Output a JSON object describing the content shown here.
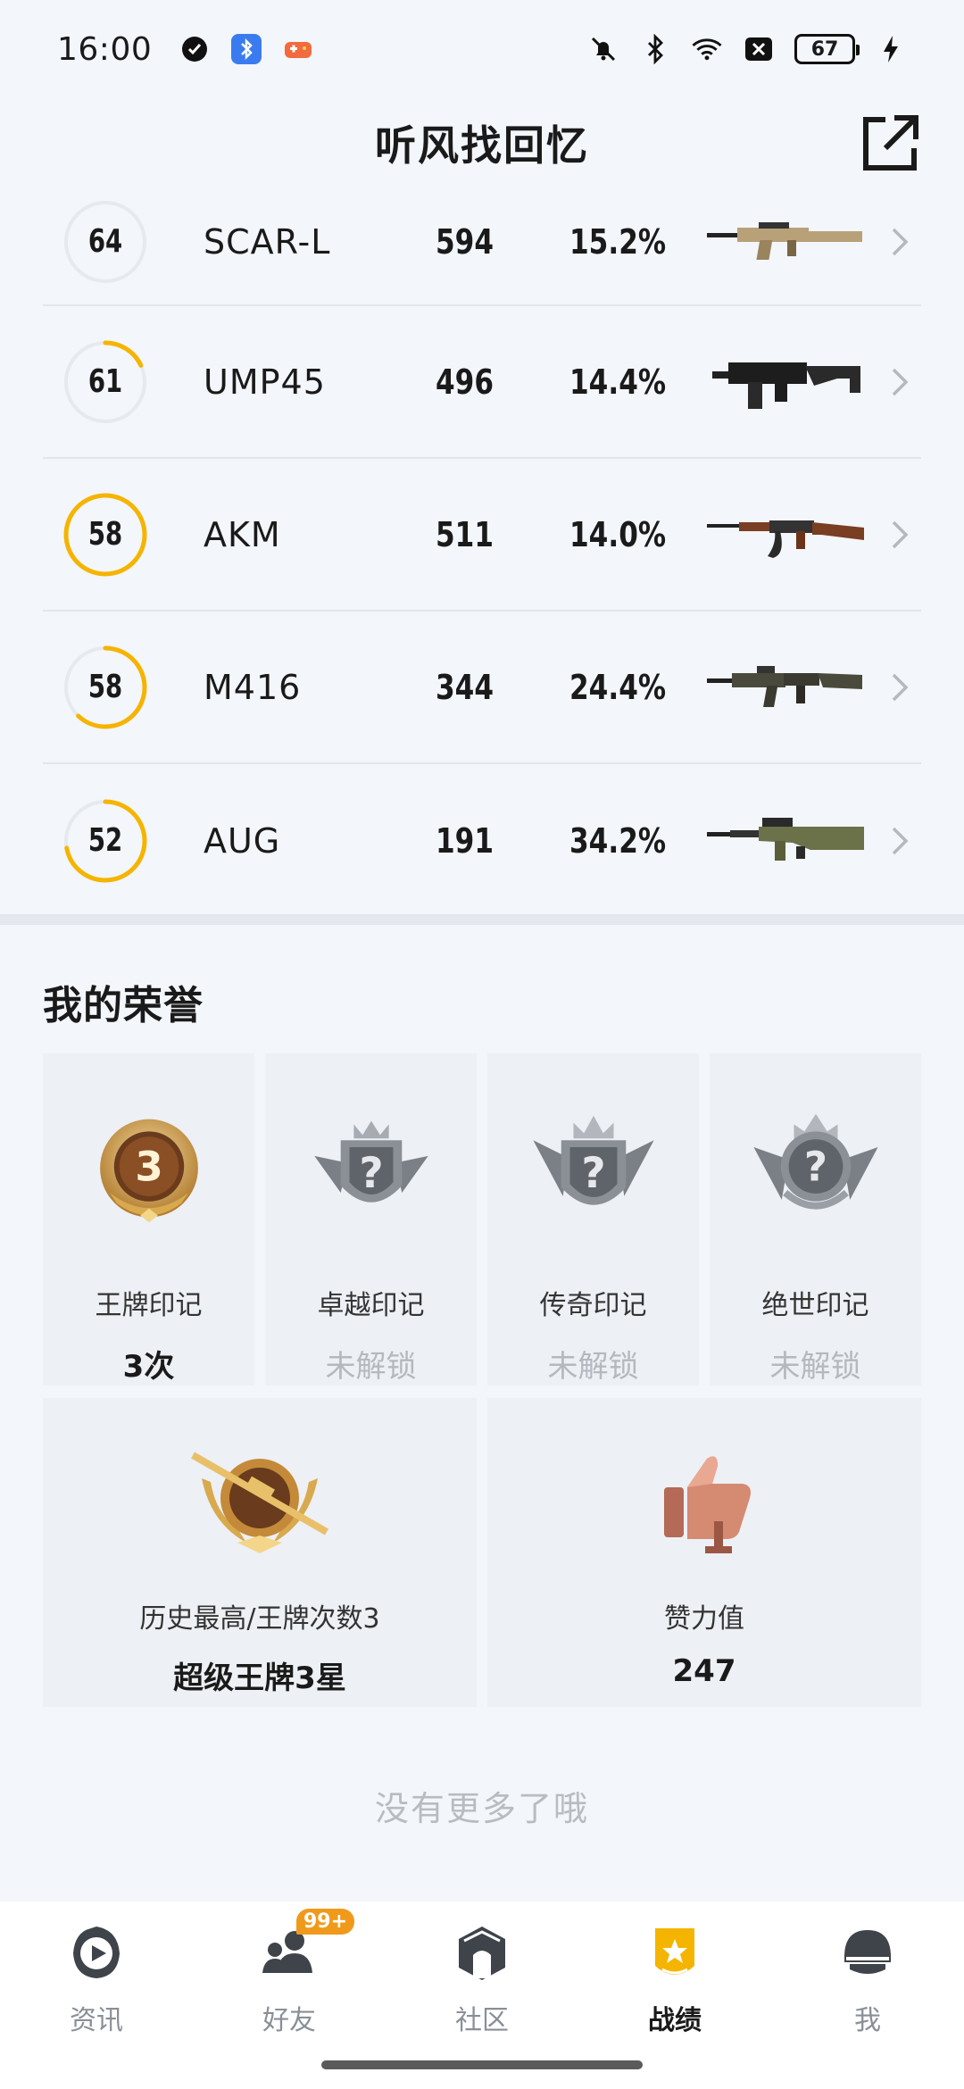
{
  "status_bar": {
    "time": "16:00",
    "battery": "67",
    "left_icons": [
      "app-shield-icon",
      "bluetooth-app-icon",
      "game-controller-icon"
    ],
    "right_icons": [
      "mute-bell-icon",
      "bluetooth-icon",
      "wifi-icon",
      "close-box-icon",
      "battery-icon",
      "charging-icon"
    ]
  },
  "header": {
    "title": "听风找回忆",
    "share_icon": "external-link-icon"
  },
  "weapons": [
    {
      "rating": "64",
      "progress": 0.0,
      "name": "SCAR-L",
      "kills": "594",
      "rate": "15.2%",
      "gun_icon": "scar-l-gun-icon"
    },
    {
      "rating": "61",
      "progress": 0.18,
      "name": "UMP45",
      "kills": "496",
      "rate": "14.4%",
      "gun_icon": "ump45-gun-icon"
    },
    {
      "rating": "58",
      "progress": 1.0,
      "name": "AKM",
      "kills": "511",
      "rate": "14.0%",
      "gun_icon": "akm-gun-icon"
    },
    {
      "rating": "58",
      "progress": 0.62,
      "name": "M416",
      "kills": "344",
      "rate": "24.4%",
      "gun_icon": "m416-gun-icon"
    },
    {
      "rating": "52",
      "progress": 0.72,
      "name": "AUG",
      "kills": "191",
      "rate": "34.2%",
      "gun_icon": "aug-gun-icon"
    }
  ],
  "honor": {
    "title": "我的荣誉",
    "cards": [
      {
        "label": "王牌印记",
        "value": "3次",
        "locked": false,
        "badge_number": "3",
        "icon": "ace-mark-badge-icon"
      },
      {
        "label": "卓越印记",
        "value": "未解锁",
        "locked": true,
        "icon": "excellence-mark-locked-icon"
      },
      {
        "label": "传奇印记",
        "value": "未解锁",
        "locked": true,
        "icon": "legend-mark-locked-icon"
      },
      {
        "label": "绝世印记",
        "value": "未解锁",
        "locked": true,
        "icon": "peerless-mark-locked-icon"
      }
    ],
    "wide_cards": [
      {
        "label": "历史最高/王牌次数3",
        "value": "超级王牌3星",
        "icon": "super-ace-rank-icon"
      },
      {
        "label": "赞力值",
        "value": "247",
        "icon": "thumbs-up-trophy-icon"
      }
    ],
    "no_more": "没有更多了哦"
  },
  "bottom_nav": {
    "items": [
      {
        "label": "资讯",
        "icon": "news-play-icon",
        "active": false
      },
      {
        "label": "好友",
        "icon": "friends-icon",
        "active": false,
        "badge": "99+"
      },
      {
        "label": "社区",
        "icon": "community-icon",
        "active": false
      },
      {
        "label": "战绩",
        "icon": "record-badge-icon",
        "active": true
      },
      {
        "label": "我",
        "icon": "helmet-icon",
        "active": false
      }
    ]
  },
  "colors": {
    "accent": "#f5b400",
    "ring_track": "#e6e9ee",
    "locked_text": "#b5b9bf",
    "badge_bg": "#f09a1c"
  }
}
